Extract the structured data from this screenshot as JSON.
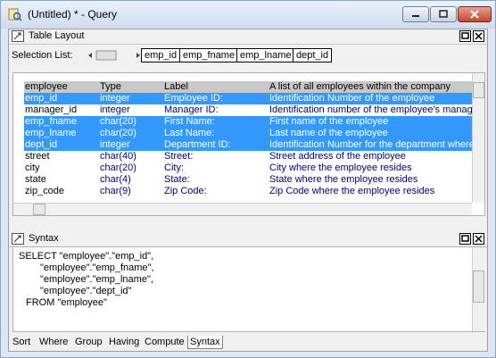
{
  "window": {
    "title": "(Untitled) * - Query"
  },
  "table_layout": {
    "title": "Table Layout",
    "selection_label": "Selection List:",
    "selection_columns": [
      "emp_id",
      "emp_fname",
      "emp_lname",
      "dept_id"
    ],
    "grid_header": [
      "employee",
      "Type",
      "Label",
      "A list of all employees within the company"
    ],
    "rows": [
      {
        "name": "emp_id",
        "type": "integer",
        "label": "Employee ID:",
        "desc": "Identification Number of the employee",
        "selected": true
      },
      {
        "name": "manager_id",
        "type": "integer",
        "label": "Manager ID:",
        "desc": "Identification number of the employee's manage",
        "selected": false
      },
      {
        "name": "emp_fname",
        "type": "char(20)",
        "label": "First Name:",
        "desc": "First name of the employee",
        "selected": true
      },
      {
        "name": "emp_lname",
        "type": "char(20)",
        "label": "Last Name:",
        "desc": "Last name of the employee",
        "selected": true
      },
      {
        "name": "dept_id",
        "type": "integer",
        "label": "Department ID:",
        "desc": "Identification Number for the department where",
        "selected": true
      },
      {
        "name": "street",
        "type": "char(40)",
        "label": "Street:",
        "desc": "Street address of the employee",
        "selected": false
      },
      {
        "name": "city",
        "type": "char(20)",
        "label": "City:",
        "desc": "City where the employee resides",
        "selected": false
      },
      {
        "name": "state",
        "type": "char(4)",
        "label": "State:",
        "desc": "State where the employee resides",
        "selected": false
      },
      {
        "name": "zip_code",
        "type": "char(9)",
        "label": "Zip Code:",
        "desc": "Zip Code where the employee resides",
        "selected": false
      }
    ]
  },
  "syntax": {
    "title": "Syntax",
    "lines": [
      "SELECT \"employee\".\"emp_id\",",
      "\"employee\".\"emp_fname\",",
      "\"employee\".\"emp_lname\",",
      "\"employee\".\"dept_id\"",
      "FROM \"employee\""
    ]
  },
  "tabs": [
    "Sort",
    "Where",
    "Group",
    "Having",
    "Compute",
    "Syntax"
  ],
  "active_tab": "Syntax",
  "colors": {
    "selection": "#3399ff",
    "header": "#c8c8c8",
    "value_text": "#000080"
  }
}
